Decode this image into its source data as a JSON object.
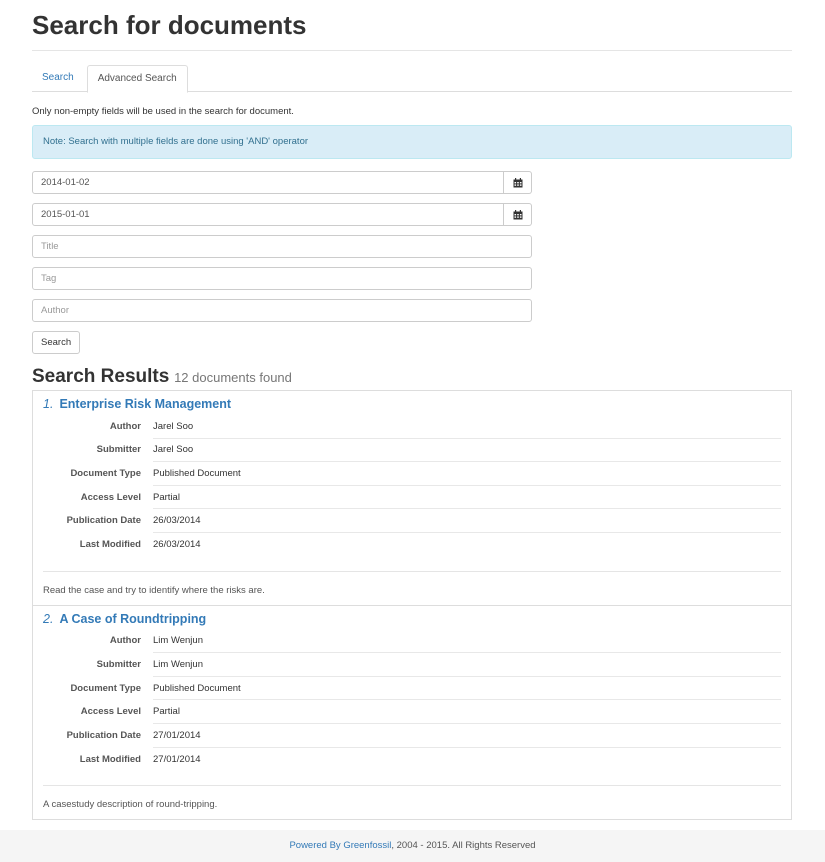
{
  "page": {
    "title": "Search for documents"
  },
  "tabs": [
    {
      "label": "Search"
    },
    {
      "label": "Advanced Search"
    }
  ],
  "form": {
    "help_text": "Only non-empty fields will be used in the search for document.",
    "note": "Note: Search with multiple fields are done using 'AND' operator",
    "date_from": "2014-01-02",
    "date_to": "2015-01-01",
    "title_placeholder": "Title",
    "tag_placeholder": "Tag",
    "author_placeholder": "Author",
    "search_button": "Search"
  },
  "results": {
    "heading": "Search Results",
    "count_text": "12 documents found",
    "labels": {
      "author": "Author",
      "submitter": "Submitter",
      "document_type": "Document Type",
      "access_level": "Access Level",
      "publication_date": "Publication Date",
      "last_modified": "Last Modified"
    },
    "items": [
      {
        "number": "1.",
        "title": "Enterprise Risk Management",
        "author": "Jarel Soo",
        "submitter": "Jarel Soo",
        "document_type": "Published Document",
        "access_level": "Partial",
        "publication_date": "26/03/2014",
        "last_modified": "26/03/2014",
        "description": "Read the case and try to identify where the risks are."
      },
      {
        "number": "2.",
        "title": "A Case of Roundtripping",
        "author": "Lim Wenjun",
        "submitter": "Lim Wenjun",
        "document_type": "Published Document",
        "access_level": "Partial",
        "publication_date": "27/01/2014",
        "last_modified": "27/01/2014",
        "description": "A casestudy description of round-tripping."
      }
    ]
  },
  "footer": {
    "link": "Powered By Greenfossil",
    "text": ", 2004 - 2015. All Rights Reserved"
  },
  "icons": {
    "calendar": "calendar-icon"
  }
}
